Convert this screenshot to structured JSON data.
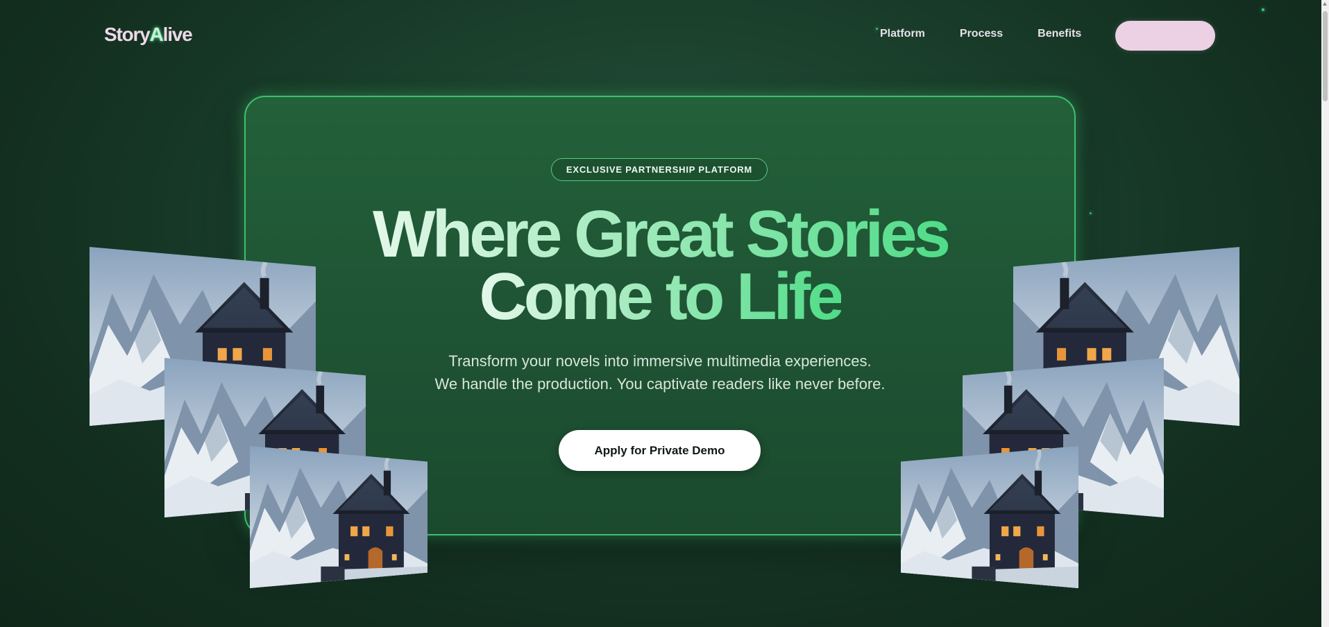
{
  "header": {
    "logo_prefix": "Story",
    "logo_accent": "A",
    "logo_suffix": "live",
    "nav": [
      "Platform",
      "Process",
      "Benefits"
    ],
    "cta_label": ""
  },
  "hero": {
    "badge": "EXCLUSIVE PARTNERSHIP PLATFORM",
    "headline_line1": "Where Great Stories",
    "headline_line2": "Come to Life",
    "subtitle_line1": "Transform your novels into immersive multimedia experiences.",
    "subtitle_line2": "We handle the production. You captivate readers like never before.",
    "cta_label": "Apply for Private Demo"
  },
  "colors": {
    "background": "#163824",
    "card_border": "#3fbf6f",
    "accent_green": "#4fdc88",
    "pill_pink": "#ecd0e4",
    "logo_pink": "#eed9e8"
  },
  "images": {
    "alt": "snowy mountain cabin illustration",
    "icon": "mountain-cabin-image"
  }
}
